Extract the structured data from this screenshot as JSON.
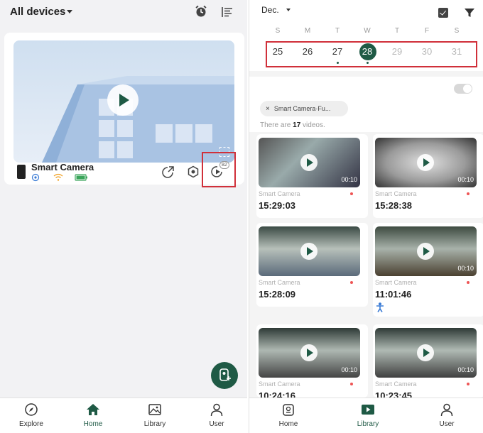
{
  "left": {
    "header": {
      "title": "All devices",
      "icons": [
        "alarm-clock-icon",
        "sort-list-icon"
      ]
    },
    "device": {
      "name": "Smart Camera",
      "status_icons": [
        "motion-icon",
        "wifi-icon",
        "battery-icon"
      ],
      "actions": [
        "share-icon",
        "settings-icon",
        "playback-icon"
      ],
      "playback_badge": "82"
    },
    "tabs": [
      {
        "label": "Explore",
        "icon": "compass-icon"
      },
      {
        "label": "Home",
        "icon": "home-icon",
        "active": true
      },
      {
        "label": "Library",
        "icon": "image-icon"
      },
      {
        "label": "User",
        "icon": "user-icon"
      }
    ]
  },
  "right": {
    "calendar": {
      "month": "Dec.",
      "weekdays": [
        "S",
        "M",
        "T",
        "W",
        "T",
        "F",
        "S"
      ],
      "days": [
        {
          "label": "25",
          "state": "normal",
          "has_events": false
        },
        {
          "label": "26",
          "state": "normal",
          "has_events": false
        },
        {
          "label": "27",
          "state": "normal",
          "has_events": true
        },
        {
          "label": "28",
          "state": "selected",
          "has_events": true
        },
        {
          "label": "29",
          "state": "dim",
          "has_events": false
        },
        {
          "label": "30",
          "state": "dim",
          "has_events": false
        },
        {
          "label": "31",
          "state": "dim",
          "has_events": false
        }
      ]
    },
    "filter": {
      "chip_label": "Smart Camera·Fu...",
      "count_prefix": "There are",
      "count": "17",
      "count_suffix": "videos."
    },
    "videos": [
      {
        "camera": "Smart Camera",
        "time": "15:29:03",
        "duration": "00:10"
      },
      {
        "camera": "Smart Camera",
        "time": "15:28:38",
        "duration": "00:10"
      },
      {
        "camera": "Smart Camera",
        "time": "15:28:09",
        "duration": ""
      },
      {
        "camera": "Smart Camera",
        "time": "11:01:46",
        "duration": "00:10"
      },
      {
        "camera": "Smart Camera",
        "time": "10:24:16",
        "duration": "00:10"
      },
      {
        "camera": "Smart Camera",
        "time": "10:23:45",
        "duration": "00:10"
      }
    ],
    "tabs": [
      {
        "label": "Home",
        "icon": "home-icon"
      },
      {
        "label": "Library",
        "icon": "video-icon",
        "active": true
      },
      {
        "label": "User",
        "icon": "user-icon"
      }
    ]
  },
  "colors": {
    "brand_green": "#1f5a45",
    "highlight_red": "#d0303a"
  }
}
